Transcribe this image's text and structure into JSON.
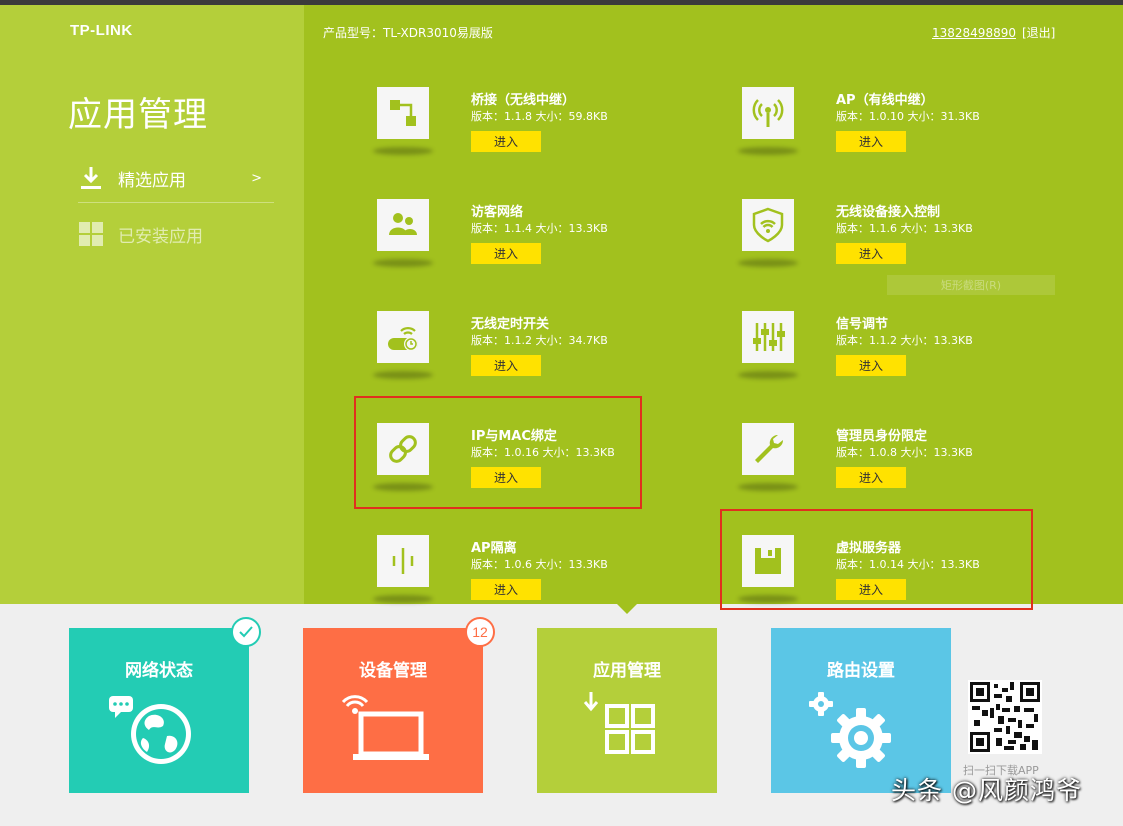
{
  "header": {
    "logo": "TP-LINK",
    "product_model": "产品型号：TL-XDR3010易展版",
    "account": "13828498890",
    "logout": "[退出]"
  },
  "sidebar": {
    "title": "应用管理",
    "items": [
      {
        "label": "精选应用",
        "chevron": ">",
        "icon": "download-icon"
      },
      {
        "label": "已安装应用",
        "icon": "grid-icon"
      }
    ]
  },
  "apps": [
    {
      "name": "桥接（无线中继）",
      "meta": "版本：1.1.8 大小：59.8KB",
      "button": "进入",
      "icon": "bridge-icon"
    },
    {
      "name": "AP（有线中继）",
      "meta": "版本：1.0.10 大小：31.3KB",
      "button": "进入",
      "icon": "ap-icon"
    },
    {
      "name": "访客网络",
      "meta": "版本：1.1.4 大小：13.3KB",
      "button": "进入",
      "icon": "guest-users-icon"
    },
    {
      "name": "无线设备接入控制",
      "meta": "版本：1.1.6 大小：13.3KB",
      "button": "进入",
      "icon": "wifi-shield-icon"
    },
    {
      "name": "无线定时开关",
      "meta": "版本：1.1.2 大小：34.7KB",
      "button": "进入",
      "icon": "wifi-timer-icon"
    },
    {
      "name": "信号调节",
      "meta": "版本：1.1.2 大小：13.3KB",
      "button": "进入",
      "icon": "sliders-icon"
    },
    {
      "name": "IP与MAC绑定",
      "meta": "版本：1.0.16 大小：13.3KB",
      "button": "进入",
      "icon": "link-icon"
    },
    {
      "name": "管理员身份限定",
      "meta": "版本：1.0.8 大小：13.3KB",
      "button": "进入",
      "icon": "wrench-icon"
    },
    {
      "name": "AP隔离",
      "meta": "版本：1.0.6 大小：13.3KB",
      "button": "进入",
      "icon": "ap-isolation-icon"
    },
    {
      "name": "虚拟服务器",
      "meta": "版本：1.0.14 大小：13.3KB",
      "button": "进入",
      "icon": "server-disk-icon"
    }
  ],
  "screenshot_hint": "矩形截图(R)",
  "nav": [
    {
      "title": "网络状态",
      "icon": "globe-icon",
      "color": "#23ccb4"
    },
    {
      "title": "设备管理",
      "icon": "laptop-icon",
      "color": "#fe6e45",
      "badge": "12"
    },
    {
      "title": "应用管理",
      "icon": "apps-grid-icon",
      "color": "#b4cf3a"
    },
    {
      "title": "路由设置",
      "icon": "gear-icon",
      "color": "#5bc6e6"
    }
  ],
  "qr": {
    "label": "扫一扫下载APP"
  },
  "watermark": "头条 @风颜鸿爷",
  "colors": {
    "sidebar": "#b4cf3a",
    "main": "#a2c11e",
    "button": "#ffe200",
    "highlight": "#e0301e"
  }
}
